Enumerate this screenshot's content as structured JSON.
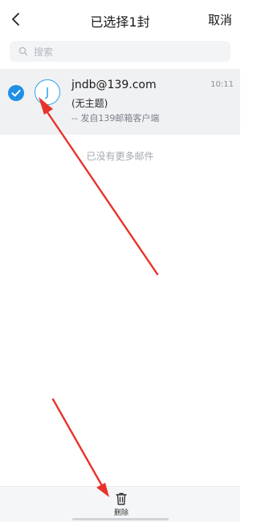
{
  "header": {
    "title": "已选择1封",
    "cancel_label": "取消"
  },
  "search": {
    "placeholder": "搜索"
  },
  "mail": {
    "avatar_letter": "J",
    "sender": "jndb@139.com",
    "time": "10:11",
    "subject": "(无主题)",
    "preview": "-- 发自139邮箱客户端",
    "selected": true
  },
  "list": {
    "end_text": "已没有更多邮件"
  },
  "toolbar": {
    "delete_label": "删除"
  },
  "colors": {
    "accent": "#1f8fe5",
    "avatar": "#2aa3e6",
    "annotation_arrow": "#e8322b"
  }
}
